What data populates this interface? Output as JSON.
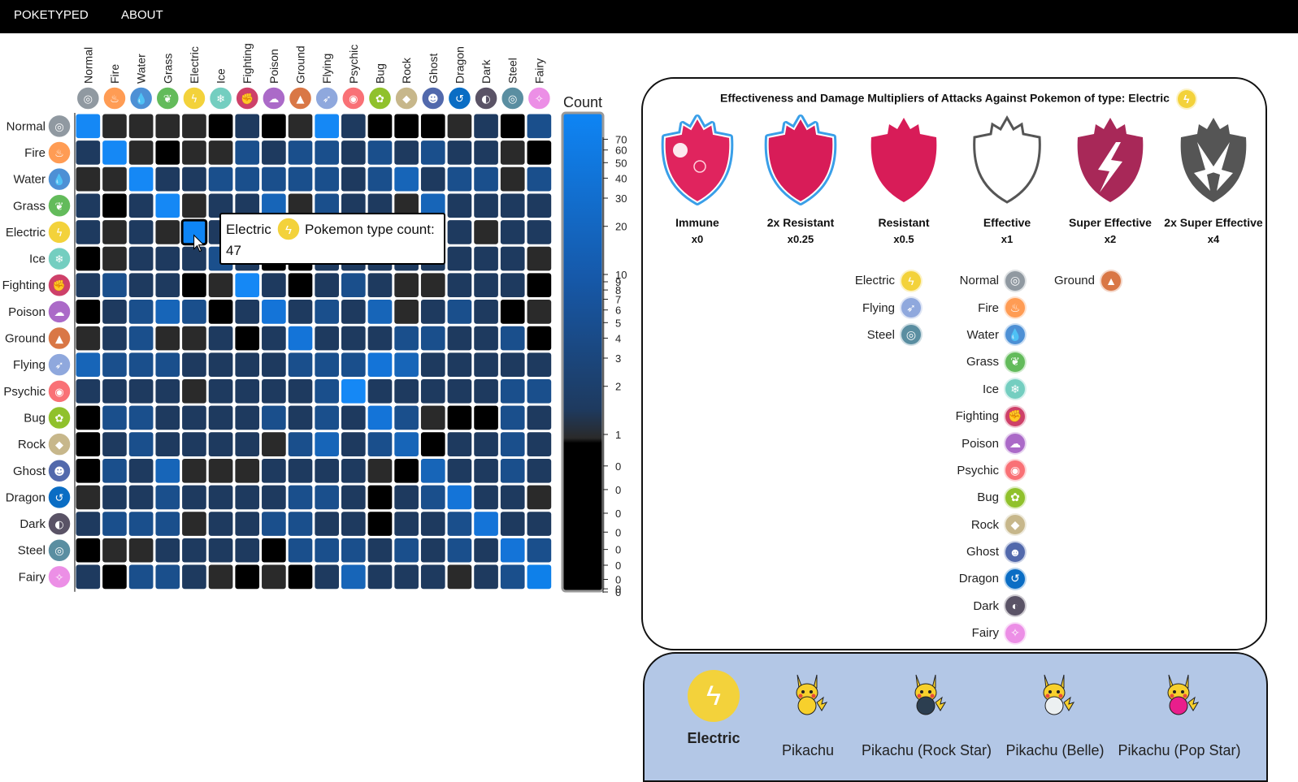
{
  "nav": {
    "brand": "POKETYPED",
    "about": "ABOUT"
  },
  "types": [
    {
      "name": "Normal",
      "color": "#9099a1",
      "glyph": "◎"
    },
    {
      "name": "Fire",
      "color": "#ff9c54",
      "glyph": "♨"
    },
    {
      "name": "Water",
      "color": "#4d90d5",
      "glyph": "💧"
    },
    {
      "name": "Grass",
      "color": "#63bb5b",
      "glyph": "❦"
    },
    {
      "name": "Electric",
      "color": "#f3d23b",
      "glyph": "ϟ"
    },
    {
      "name": "Ice",
      "color": "#74cec0",
      "glyph": "❄"
    },
    {
      "name": "Fighting",
      "color": "#ce4069",
      "glyph": "✊"
    },
    {
      "name": "Poison",
      "color": "#ab6ac8",
      "glyph": "☁"
    },
    {
      "name": "Ground",
      "color": "#d97746",
      "glyph": "▲"
    },
    {
      "name": "Flying",
      "color": "#8fa8dd",
      "glyph": "➶"
    },
    {
      "name": "Psychic",
      "color": "#f97176",
      "glyph": "◉"
    },
    {
      "name": "Bug",
      "color": "#90c12c",
      "glyph": "✿"
    },
    {
      "name": "Rock",
      "color": "#c7b78b",
      "glyph": "◆"
    },
    {
      "name": "Ghost",
      "color": "#5269ac",
      "glyph": "☻"
    },
    {
      "name": "Dragon",
      "color": "#0a6dc4",
      "glyph": "↺"
    },
    {
      "name": "Dark",
      "color": "#5a5366",
      "glyph": "◐"
    },
    {
      "name": "Steel",
      "color": "#5a8ea1",
      "glyph": "◎"
    },
    {
      "name": "Fairy",
      "color": "#ec8fe6",
      "glyph": "✧"
    }
  ],
  "chart_data": {
    "type": "heatmap",
    "legend_title": "Count",
    "legend_ticks": [
      "70",
      "60",
      "50",
      "40",
      "30",
      "20",
      "10",
      "9",
      "8",
      "7",
      "6",
      "5",
      "4",
      "3",
      "2",
      "1",
      "0",
      "0",
      "0",
      "0",
      "0",
      "0",
      "0",
      "0",
      "0"
    ],
    "legend_tick_values": [
      70,
      60,
      50,
      40,
      30,
      20,
      10,
      9,
      8,
      7,
      6,
      5,
      4,
      3,
      2,
      1,
      0.8,
      0.65,
      0.5,
      0.38,
      0.27,
      0.17,
      0.08,
      0.02,
      0
    ],
    "grid": [
      [
        5,
        0.5,
        0.5,
        0.5,
        0.5,
        0,
        1.5,
        0,
        0.5,
        4,
        1.5,
        0,
        0,
        0,
        0.5,
        1.5,
        0,
        2
      ],
      [
        1.5,
        4,
        0.5,
        0,
        0.5,
        0.5,
        2,
        1.5,
        2,
        2,
        1.5,
        2,
        1.5,
        2,
        1.5,
        1.5,
        0.5,
        0
      ],
      [
        0.5,
        0.5,
        5,
        1.5,
        1.5,
        2,
        2,
        2,
        2,
        2,
        1.5,
        2,
        2.5,
        1.5,
        2,
        2,
        0.5,
        2
      ],
      [
        1.5,
        0,
        1.5,
        4,
        0.5,
        1.5,
        1.5,
        2.5,
        0.5,
        2,
        1.5,
        1.5,
        0.5,
        2.5,
        1.5,
        1.5,
        1.5,
        1.5
      ],
      [
        1.5,
        0.5,
        1.5,
        0.5,
        5,
        1.5,
        1.5,
        1.5,
        1.5,
        1.5,
        1.5,
        1.5,
        1.5,
        1.5,
        1.5,
        0.5,
        1.5,
        1.5
      ],
      [
        0,
        0.5,
        1.5,
        1.5,
        1.5,
        2,
        1.5,
        0,
        0,
        1.5,
        1.5,
        1.5,
        1.5,
        1.5,
        1.5,
        1.5,
        1.5,
        0.5
      ],
      [
        1.5,
        2,
        1.5,
        1.5,
        0,
        0.5,
        4,
        1.5,
        0,
        1.5,
        2,
        1.5,
        0.5,
        0.5,
        1.5,
        1.5,
        1.5,
        0
      ],
      [
        0,
        1.5,
        2,
        2.5,
        2,
        0,
        1.5,
        3,
        1.5,
        2,
        1.5,
        2.5,
        0.5,
        1.5,
        2,
        1.5,
        0,
        0.5
      ],
      [
        0.5,
        1.5,
        2,
        0.5,
        0.5,
        1.5,
        0,
        1.5,
        3,
        1.5,
        1.5,
        1.5,
        2,
        2,
        1.5,
        1.5,
        2,
        0
      ],
      [
        2.5,
        2,
        2,
        2,
        1.5,
        1.5,
        1.5,
        1.5,
        2,
        2,
        2,
        3,
        2.5,
        1.5,
        1.5,
        1.5,
        1.5,
        1.5
      ],
      [
        1.5,
        1.5,
        1.5,
        1.5,
        0.5,
        1.5,
        1.5,
        1.5,
        1.5,
        2,
        4,
        1.5,
        1.5,
        1.5,
        1.5,
        1.5,
        2,
        2
      ],
      [
        0,
        2,
        2,
        1.5,
        1.5,
        1.5,
        1.5,
        2,
        1.5,
        2,
        1.5,
        3,
        2,
        0.5,
        0,
        0,
        2,
        1.5
      ],
      [
        0,
        1.5,
        2,
        1.5,
        1.5,
        1.5,
        1.5,
        0.5,
        2,
        2.5,
        1.5,
        2,
        2.5,
        0,
        1.5,
        1.5,
        2,
        1.5
      ],
      [
        0,
        2,
        1.5,
        2.5,
        0.5,
        0.5,
        0.5,
        1.5,
        1.5,
        1.5,
        1.5,
        0.5,
        0,
        2.5,
        1.5,
        1.5,
        2,
        1.5
      ],
      [
        0.5,
        1.5,
        1.5,
        2,
        1.5,
        1.5,
        1.5,
        1.5,
        2,
        2,
        1.5,
        0,
        1.5,
        2,
        3,
        1.5,
        1.5,
        0.5
      ],
      [
        1.5,
        2,
        2,
        2,
        0.5,
        1.5,
        1.5,
        2,
        2,
        1.5,
        1.5,
        0,
        1.5,
        1.5,
        2,
        3,
        1.5,
        1.5
      ],
      [
        0,
        0.5,
        0.5,
        1.5,
        1.5,
        1.5,
        1.5,
        0,
        2,
        2,
        2,
        1.5,
        2,
        1.5,
        2,
        1.5,
        3,
        2
      ],
      [
        1.5,
        0,
        2,
        2,
        1.5,
        0.5,
        0,
        0.5,
        0,
        1.5,
        2.5,
        1.5,
        1.5,
        1.5,
        0.5,
        1.5,
        2,
        3.5
      ]
    ],
    "highlight": {
      "row": 4,
      "col": 4
    }
  },
  "tooltip": {
    "type": "Electric",
    "text_after": "Pokemon type count:",
    "count": "47"
  },
  "panel": {
    "title": "Effectiveness and Damage Multipliers of Attacks Against Pokemon of type: Electric",
    "multipliers": [
      {
        "label": "Immune",
        "value": "x0"
      },
      {
        "label": "2x Resistant",
        "value": "x0.25"
      },
      {
        "label": "Resistant",
        "value": "x0.5"
      },
      {
        "label": "Effective",
        "value": "x1"
      },
      {
        "label": "Super Effective",
        "value": "x2"
      },
      {
        "label": "2x Super Effective",
        "value": "x4"
      }
    ],
    "resistant": [
      "Electric",
      "Flying",
      "Steel"
    ],
    "effective": [
      "Normal",
      "Fire",
      "Water",
      "Grass",
      "Ice",
      "Fighting",
      "Poison",
      "Psychic",
      "Bug",
      "Rock",
      "Ghost",
      "Dragon",
      "Dark",
      "Fairy"
    ],
    "super_effective": [
      "Ground"
    ]
  },
  "pokemon": {
    "type_label": "Electric",
    "list": [
      "Pikachu",
      "Pikachu (Rock Star)",
      "Pikachu (Belle)",
      "Pikachu (Pop Star)"
    ]
  }
}
